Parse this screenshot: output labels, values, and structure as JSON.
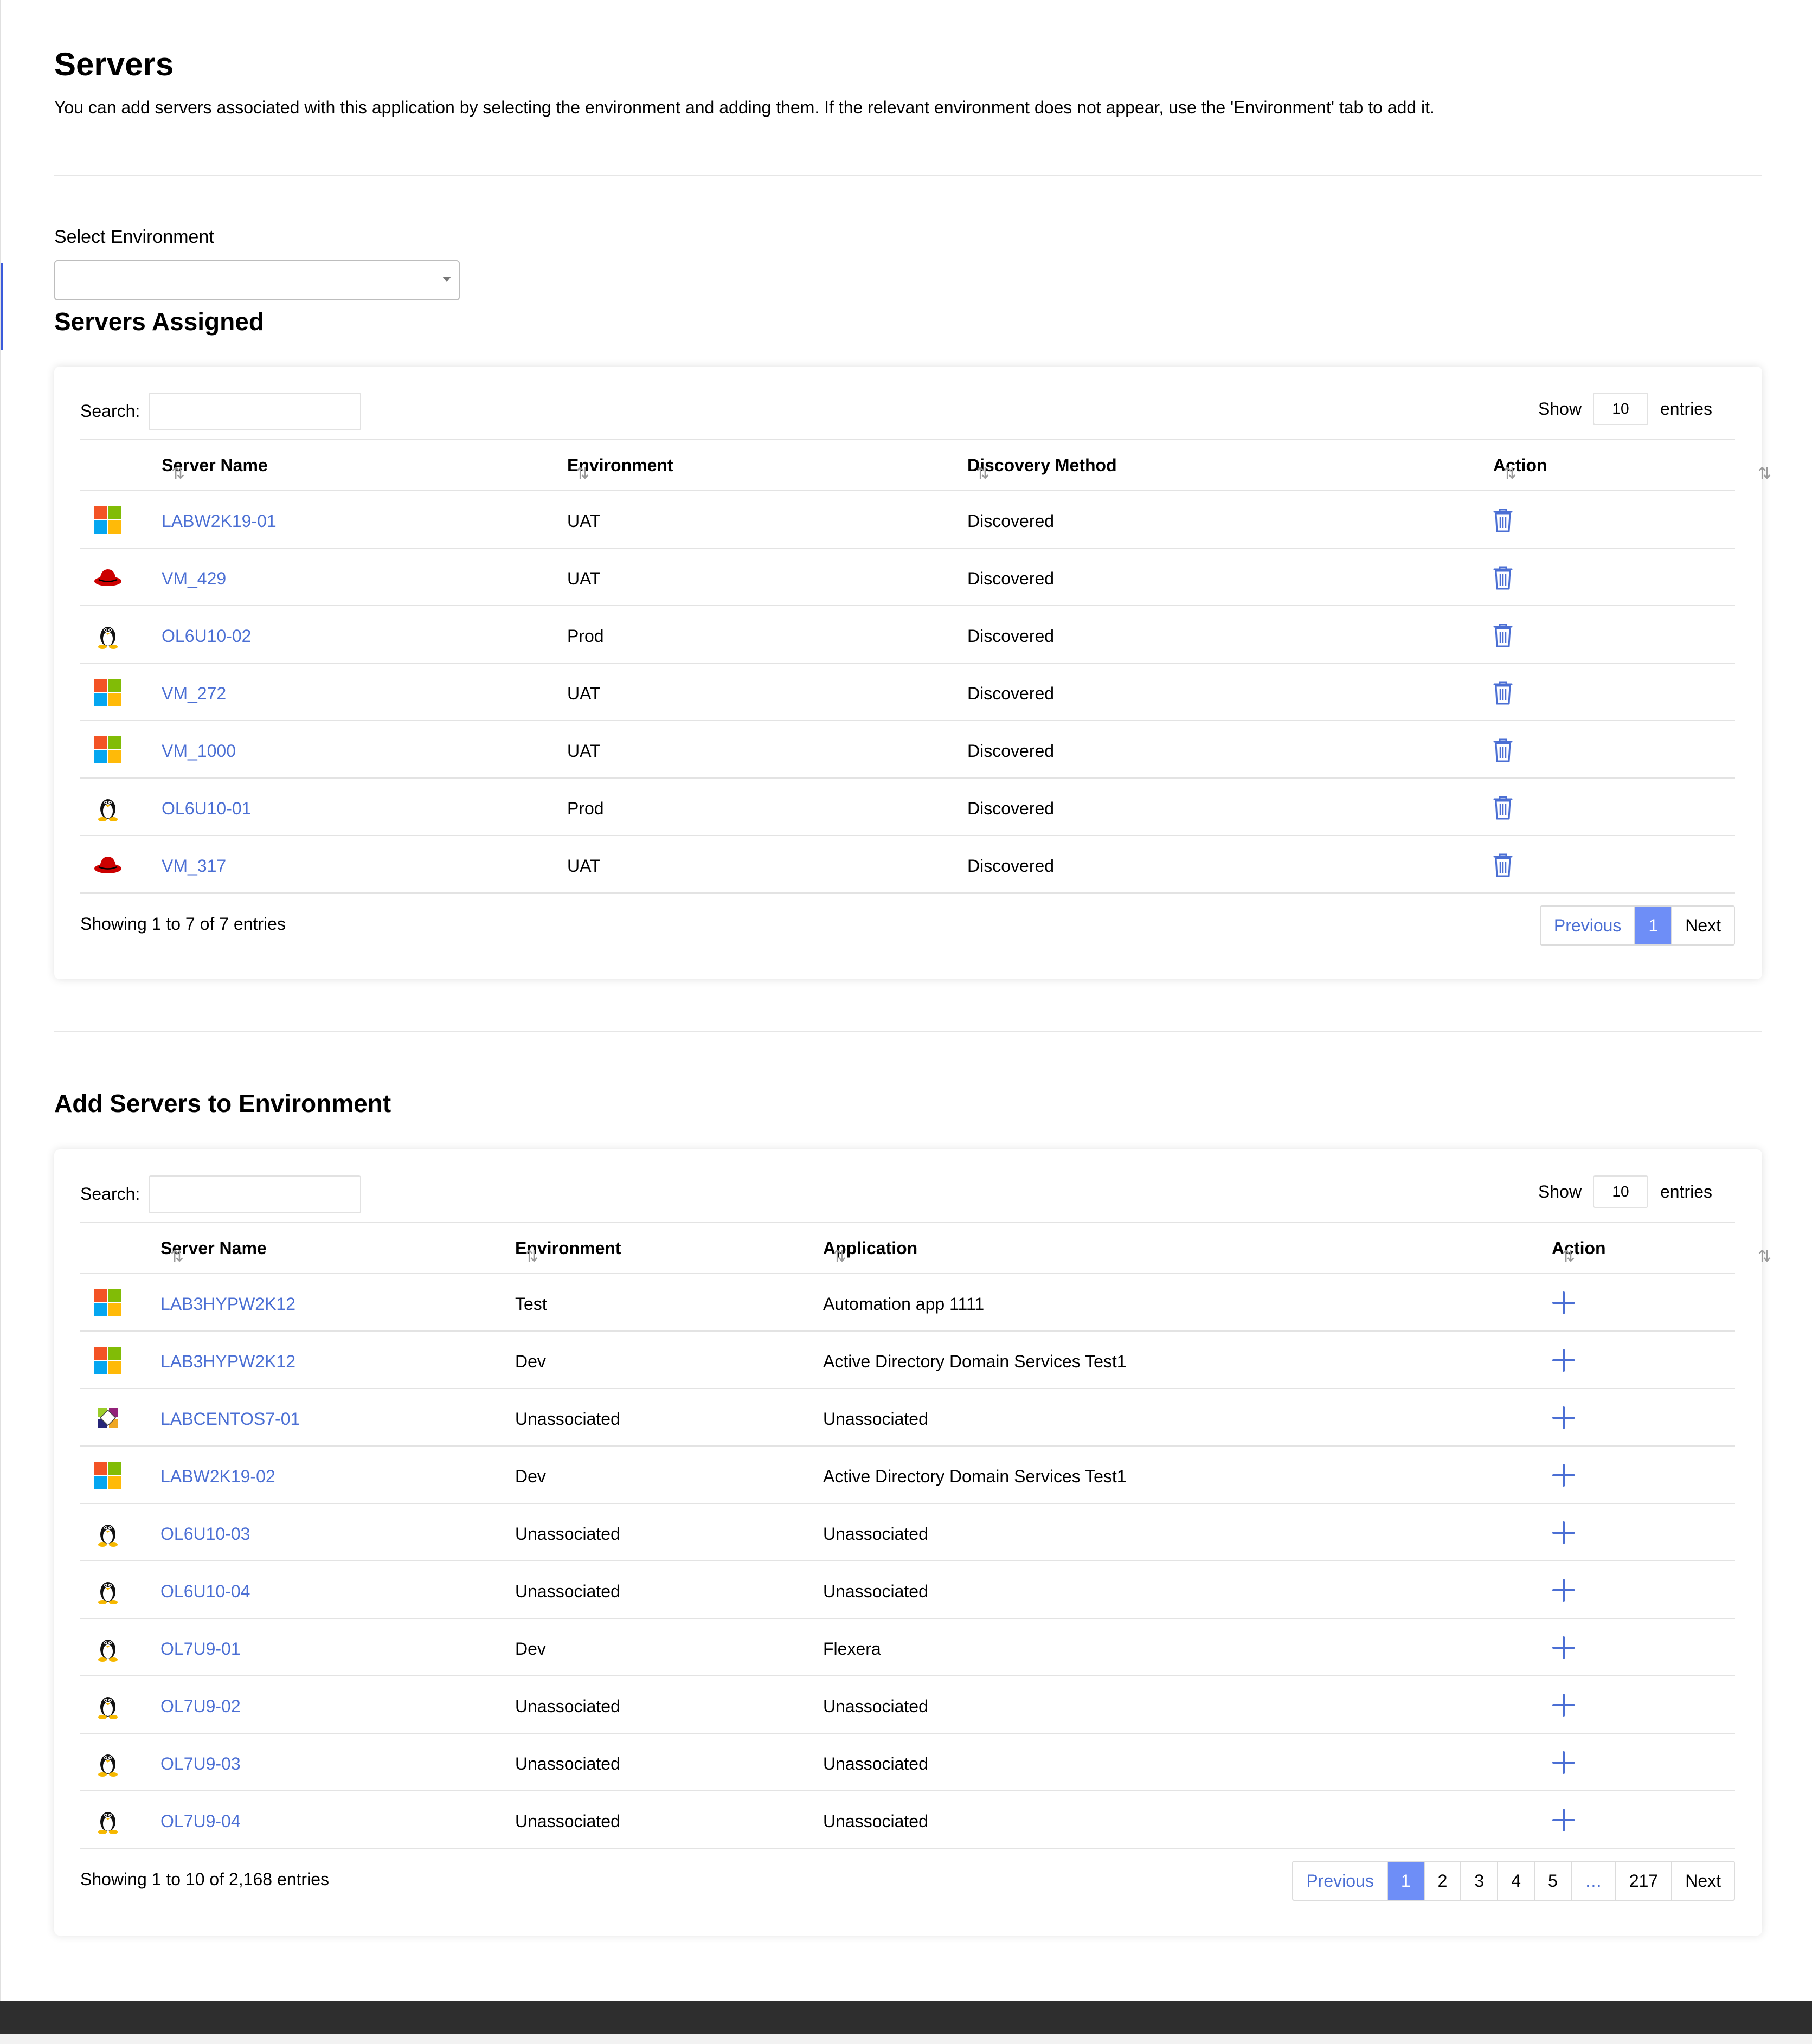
{
  "page": {
    "title": "Servers",
    "intro": "You can add servers associated with this application by selecting the environment and adding them. If the relevant environment does not appear, use the 'Environment' tab to add it.",
    "select_environment_label": "Select Environment",
    "select_environment_value": ""
  },
  "assigned": {
    "heading": "Servers Assigned",
    "search_label": "Search:",
    "show_label": "Show",
    "show_value": "10",
    "entries_label": "entries",
    "columns": [
      "Server Name",
      "Environment",
      "Discovery Method",
      "Action"
    ],
    "rows": [
      {
        "os": "windows-icon",
        "name": "LABW2K19-01",
        "environment": "UAT",
        "discovery": "Discovered"
      },
      {
        "os": "redhat-icon",
        "name": "VM_429",
        "environment": "UAT",
        "discovery": "Discovered"
      },
      {
        "os": "linux-icon",
        "name": "OL6U10-02",
        "environment": "Prod",
        "discovery": "Discovered"
      },
      {
        "os": "windows-icon",
        "name": "VM_272",
        "environment": "UAT",
        "discovery": "Discovered"
      },
      {
        "os": "windows-icon",
        "name": "VM_1000",
        "environment": "UAT",
        "discovery": "Discovered"
      },
      {
        "os": "linux-icon",
        "name": "OL6U10-01",
        "environment": "Prod",
        "discovery": "Discovered"
      },
      {
        "os": "redhat-icon",
        "name": "VM_317",
        "environment": "UAT",
        "discovery": "Discovered"
      }
    ],
    "footer": "Showing 1 to 7 of 7 entries",
    "pagination": {
      "previous": "Previous",
      "pages": [
        "1"
      ],
      "active": "1",
      "next": "Next"
    }
  },
  "add": {
    "heading": "Add Servers to Environment",
    "search_label": "Search:",
    "show_label": "Show",
    "show_value": "10",
    "entries_label": "entries",
    "columns": [
      "Server Name",
      "Environment",
      "Application",
      "Action"
    ],
    "rows": [
      {
        "os": "windows-icon",
        "name": "LAB3HYPW2K12",
        "environment": "Test",
        "application": "Automation app 1111"
      },
      {
        "os": "windows-icon",
        "name": "LAB3HYPW2K12",
        "environment": "Dev",
        "application": "Active Directory Domain Services Test1"
      },
      {
        "os": "centos-icon",
        "name": "LABCENTOS7-01",
        "environment": "Unassociated",
        "application": "Unassociated"
      },
      {
        "os": "windows-icon",
        "name": "LABW2K19-02",
        "environment": "Dev",
        "application": "Active Directory Domain Services Test1"
      },
      {
        "os": "linux-icon",
        "name": "OL6U10-03",
        "environment": "Unassociated",
        "application": "Unassociated"
      },
      {
        "os": "linux-icon",
        "name": "OL6U10-04",
        "environment": "Unassociated",
        "application": "Unassociated"
      },
      {
        "os": "linux-icon",
        "name": "OL7U9-01",
        "environment": "Dev",
        "application": "Flexera"
      },
      {
        "os": "linux-icon",
        "name": "OL7U9-02",
        "environment": "Unassociated",
        "application": "Unassociated"
      },
      {
        "os": "linux-icon",
        "name": "OL7U9-03",
        "environment": "Unassociated",
        "application": "Unassociated"
      },
      {
        "os": "linux-icon",
        "name": "OL7U9-04",
        "environment": "Unassociated",
        "application": "Unassociated"
      }
    ],
    "footer": "Showing 1 to 10 of 2,168 entries",
    "pagination": {
      "previous": "Previous",
      "pages": [
        "1",
        "2",
        "3",
        "4",
        "5",
        "…",
        "217"
      ],
      "active": "1",
      "next": "Next"
    }
  },
  "colors": {
    "link": "#4b6fd4",
    "accent": "#6e8ef7",
    "windows": [
      "#f35325",
      "#81bc06",
      "#05a6f0",
      "#ffba08"
    ],
    "redhat": "#cc0000"
  }
}
